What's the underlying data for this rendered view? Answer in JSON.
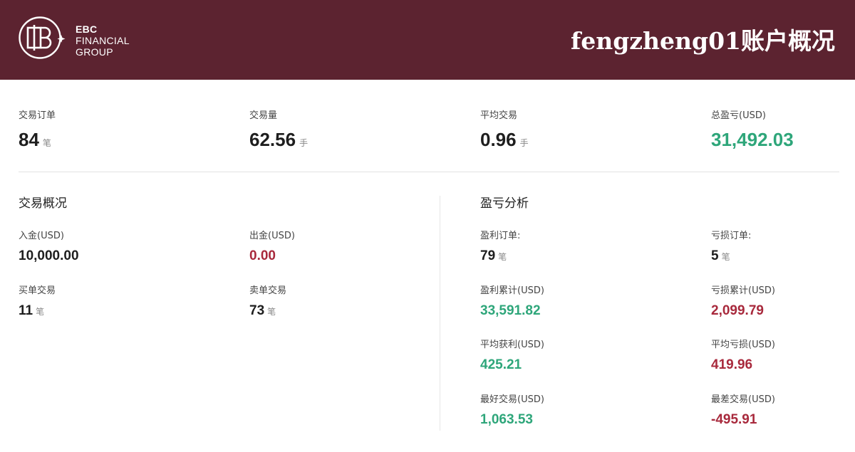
{
  "brand": {
    "logo_line1": "EBC",
    "logo_line2": "FINANCIAL",
    "logo_line3": "GROUP"
  },
  "header": {
    "title": "fengzheng01账户概况",
    "background_color": "#5c2330"
  },
  "summary": [
    {
      "label": "交易订单",
      "value": "84",
      "unit": "笔"
    },
    {
      "label": "交易量",
      "value": "62.56",
      "unit": "手"
    },
    {
      "label": "平均交易",
      "value": "0.96",
      "unit": "手"
    },
    {
      "label": "总盈亏(USD)",
      "value": "31,492.03",
      "unit": ""
    }
  ],
  "overview": {
    "title": "交易概况",
    "deposit": {
      "label": "入金(USD)",
      "value": "10,000.00"
    },
    "withdrawal": {
      "label": "出金(USD)",
      "value": "0.00"
    },
    "buy_trades": {
      "label": "买单交易",
      "value": "11",
      "unit": "笔"
    },
    "sell_trades": {
      "label": "卖单交易",
      "value": "73",
      "unit": "笔"
    }
  },
  "pnl": {
    "title": "盈亏分析",
    "profit_orders": {
      "label": "盈利订单:",
      "value": "79",
      "unit": "笔"
    },
    "loss_orders": {
      "label": "亏损订单:",
      "value": "5",
      "unit": "笔"
    },
    "profit_total": {
      "label": "盈利累计(USD)",
      "value": "33,591.82"
    },
    "loss_total": {
      "label": "亏损累计(USD)",
      "value": "2,099.79"
    },
    "avg_profit": {
      "label": "平均获利(USD)",
      "value": "425.21"
    },
    "avg_loss": {
      "label": "平均亏损(USD)",
      "value": "419.96"
    },
    "best_trade": {
      "label": "最好交易(USD)",
      "value": "1,063.53"
    },
    "worst_trade": {
      "label": "最差交易(USD)",
      "value": "-495.91"
    }
  },
  "colors": {
    "positive": "#2ea67a",
    "negative": "#a8293c"
  }
}
